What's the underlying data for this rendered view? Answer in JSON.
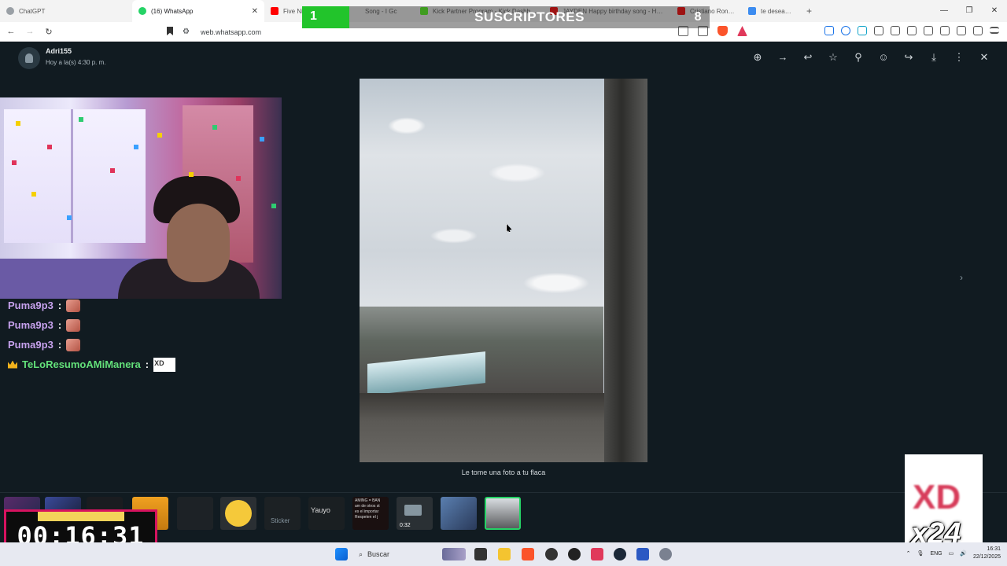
{
  "browser": {
    "tabs": [
      {
        "label": "ChatGPT",
        "active": false,
        "color": "#9aa0a6"
      },
      {
        "label": "(16) WhatsApp",
        "active": true,
        "color": "#25d366"
      },
      {
        "label": "Five Nig",
        "active": false,
        "color": "#ff0000"
      },
      {
        "label": "Song - I Gc",
        "active": false,
        "color": "#ff0000"
      },
      {
        "label": "Kick Partner Program - Kick Dashboard",
        "active": false,
        "color": "#53fc18"
      },
      {
        "label": "JAYDEN Happy birthday song - Happ",
        "active": false,
        "color": "#ff0000"
      },
      {
        "label": "Cristiano Ronaldo",
        "active": false,
        "color": "#ff0000"
      },
      {
        "label": "te desea un fe",
        "active": false,
        "color": "#3c8cf0"
      }
    ],
    "url": "web.whatsapp.com"
  },
  "subscriber_overlay": {
    "current": "1",
    "label": "SUSCRIPTORES",
    "goal": "8"
  },
  "viewer": {
    "sender": "Adri155",
    "timestamp": "Hoy a la(s) 4:30 p. m.",
    "caption": "Le tome una foto a tu flaca",
    "header_icons": [
      "zoom-in-icon",
      "arrow-right-icon",
      "reply-icon",
      "star-icon",
      "pin-icon",
      "emoji-icon",
      "forward-icon",
      "download-icon",
      "more-icon",
      "close-icon"
    ]
  },
  "chat": [
    {
      "user": "Puma9p3",
      "colon": ":",
      "type": "emote"
    },
    {
      "user": "Puma9p3",
      "colon": ":",
      "type": "emote"
    },
    {
      "user": "Puma9p3",
      "colon": ":",
      "type": "emote"
    },
    {
      "user": "TeLoResumoAMiManera",
      "colon": ":",
      "type": "badge",
      "badge_text": "XD"
    }
  ],
  "thumbnails": {
    "sticker_label": "Sticker",
    "yauyo_label": "Yauyo",
    "text_thumb": "AMING = BAN\nam de otros st\nes el importar\nRespeten el j",
    "video_duration": "0:32"
  },
  "timer": {
    "time": "00:16:31"
  },
  "xd_overlay": {
    "text": "XD",
    "multiplier": "x24"
  },
  "taskbar": {
    "search_placeholder": "Buscar",
    "lang": "ENG",
    "time": "16:31",
    "date": "22/12/2025"
  }
}
